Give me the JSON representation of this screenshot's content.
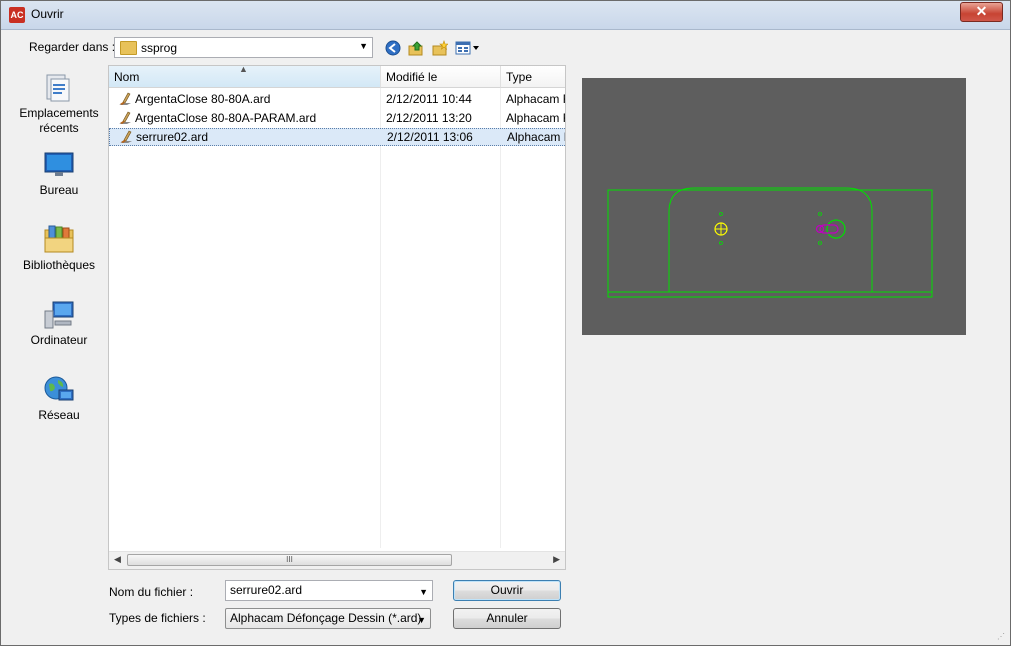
{
  "window": {
    "title": "Ouvrir",
    "app_badge": "AC",
    "close_glyph": "✕"
  },
  "lookin": {
    "label": "Regarder dans :",
    "value": "ssprog",
    "folder_icon": "folder-icon"
  },
  "toolbar": {
    "icons": [
      "back-icon",
      "up-folder-icon",
      "new-folder-icon",
      "view-menu-icon"
    ]
  },
  "places": [
    {
      "label": "Emplacements récents",
      "icon": "recent-places-icon"
    },
    {
      "label": "Bureau",
      "icon": "desktop-icon"
    },
    {
      "label": "Bibliothèques",
      "icon": "libraries-icon"
    },
    {
      "label": "Ordinateur",
      "icon": "computer-icon"
    },
    {
      "label": "Réseau",
      "icon": "network-icon"
    }
  ],
  "filelist": {
    "columns": [
      "Nom",
      "Modifié le",
      "Type"
    ],
    "rows": [
      {
        "name": "ArgentaClose 80-80A.ard",
        "modified": "2/12/2011 10:44",
        "type": "Alphacam F"
      },
      {
        "name": "ArgentaClose 80-80A-PARAM.ard",
        "modified": "2/12/2011 13:20",
        "type": "Alphacam F"
      },
      {
        "name": "serrure02.ard",
        "modified": "2/12/2011 13:06",
        "type": "Alphacam F",
        "selected": true
      }
    ],
    "scroll_grip": "III"
  },
  "footer": {
    "filename_label": "Nom du fichier :",
    "filename_value": "serrure02.ard",
    "filetype_label": "Types de fichiers :",
    "filetype_value": "Alphacam Défonçage Dessin (*.ard)",
    "open_label": "Ouvrir",
    "cancel_label": "Annuler"
  },
  "colors": {
    "preview_bg": "#5e5e5e",
    "geometry": "#00e000",
    "marker": "#ffff00",
    "tool": "#c000c0"
  }
}
